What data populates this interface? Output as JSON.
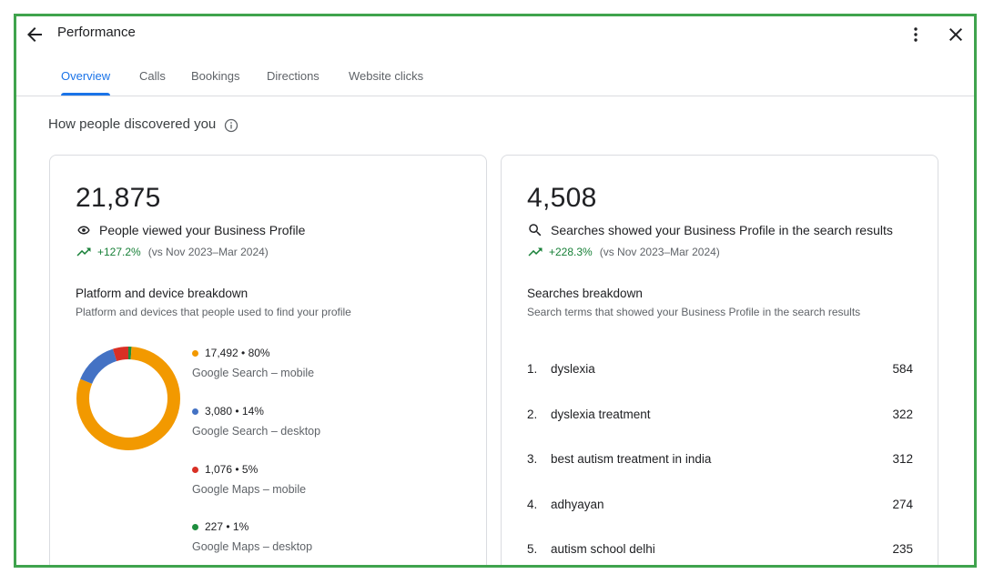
{
  "header": {
    "title": "Performance",
    "tabs": [
      "Overview",
      "Calls",
      "Bookings",
      "Directions",
      "Website clicks"
    ],
    "active_tab": "Overview"
  },
  "section": {
    "title": "How people discovered you"
  },
  "profile_views": {
    "value": "21,875",
    "label": "People viewed your Business Profile",
    "trend": "+127.2%",
    "period": "(vs Nov 2023–Mar 2024)",
    "breakdown_title": "Platform and device breakdown",
    "breakdown_desc": "Platform and devices that people used to find your profile",
    "platforms": [
      {
        "value": "17,492 • 80%",
        "label": "Google Search – mobile",
        "color": "#f29900",
        "share": 80
      },
      {
        "value": "3,080 • 14%",
        "label": "Google Search – desktop",
        "color": "#4472c4",
        "share": 14
      },
      {
        "value": "1,076 • 5%",
        "label": "Google Maps – mobile",
        "color": "#d93025",
        "share": 5
      },
      {
        "value": "227 • 1%",
        "label": "Google Maps – desktop",
        "color": "#1e8e3e",
        "share": 1
      }
    ]
  },
  "searches": {
    "value": "4,508",
    "label": "Searches showed your Business Profile in the search results",
    "trend": "+228.3%",
    "period": "(vs Nov 2023–Mar 2024)",
    "breakdown_title": "Searches breakdown",
    "breakdown_desc": "Search terms that showed your Business Profile in the search results",
    "terms": [
      {
        "rank": "1.",
        "term": "dyslexia",
        "count": "584"
      },
      {
        "rank": "2.",
        "term": "dyslexia treatment",
        "count": "322"
      },
      {
        "rank": "3.",
        "term": "best autism treatment in india",
        "count": "312"
      },
      {
        "rank": "4.",
        "term": "adhyayan",
        "count": "274"
      },
      {
        "rank": "5.",
        "term": "autism school delhi",
        "count": "235"
      }
    ]
  },
  "icons": {
    "back": "arrow-back-icon",
    "more": "more-vert-icon",
    "close": "close-icon",
    "info": "info-icon",
    "views": "eye-icon",
    "search": "search-icon",
    "trend": "trending-up-icon"
  },
  "colors": {
    "accent": "#1a73e8",
    "trend_up": "#188038",
    "frame_border": "#3fa34d"
  }
}
